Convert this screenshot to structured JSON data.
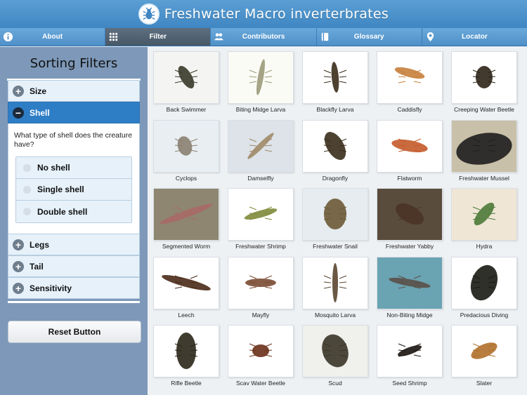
{
  "app": {
    "title": "Freshwater Macro inverterbrates",
    "logo_icon": "bug-icon"
  },
  "tabs": [
    {
      "label": "About",
      "icon": "info-icon",
      "active": false
    },
    {
      "label": "Filter",
      "icon": "grid-icon",
      "active": true
    },
    {
      "label": "Contributors",
      "icon": "people-icon",
      "active": false
    },
    {
      "label": "Glossary",
      "icon": "book-icon",
      "active": false
    },
    {
      "label": "Locator",
      "icon": "pin-icon",
      "active": false
    }
  ],
  "sidebar": {
    "title": "Sorting Filters",
    "filters": {
      "size": "Size",
      "shell": "Shell",
      "legs": "Legs",
      "tail": "Tail",
      "sensitivity": "Sensitivity"
    },
    "shell_question": "What type of shell does the creature have?",
    "shell_options": [
      "No shell",
      "Single shell",
      "Double shell"
    ],
    "reset_label": "Reset Button"
  },
  "creatures": [
    {
      "name": "Back Swimmer",
      "color": "#3a3a2a",
      "bg": "#f4f4f2"
    },
    {
      "name": "Biting Midge Larva",
      "color": "#9b9a7a",
      "bg": "#fbfbf6"
    },
    {
      "name": "Blackfly Larva",
      "color": "#3b2c1a",
      "bg": "#ffffff"
    },
    {
      "name": "Caddisfly",
      "color": "#c7803b",
      "bg": "#ffffff"
    },
    {
      "name": "Creeping Water Beetle",
      "color": "#2d2418",
      "bg": "#ffffff"
    },
    {
      "name": "Cyclops",
      "color": "#8a8070",
      "bg": "#e8eef2"
    },
    {
      "name": "Damselfly",
      "color": "#a08a68",
      "bg": "#dde3e8"
    },
    {
      "name": "Dragonfly",
      "color": "#3a2e1c",
      "bg": "#ffffff"
    },
    {
      "name": "Flatworm",
      "color": "#c45a2a",
      "bg": "#ffffff"
    },
    {
      "name": "Freshwater Mussel",
      "color": "#1e1e1e",
      "bg": "#c8c0a8"
    },
    {
      "name": "Segmented Worm",
      "color": "#a86a66",
      "bg": "#8e8670"
    },
    {
      "name": "Freshwater Shrimp",
      "color": "#7f8a3a",
      "bg": "#ffffff"
    },
    {
      "name": "Freshwater Snail",
      "color": "#6b5a36",
      "bg": "#e6ecef"
    },
    {
      "name": "Freshwater Yabby",
      "color": "#4a3426",
      "bg": "#5a4c3c"
    },
    {
      "name": "Hydra",
      "color": "#4d7a3a",
      "bg": "#efe6d6"
    },
    {
      "name": "Leech",
      "color": "#4a2a18",
      "bg": "#ffffff"
    },
    {
      "name": "Mayfly",
      "color": "#7a4a32",
      "bg": "#ffffff"
    },
    {
      "name": "Mosquito Larva",
      "color": "#5a4630",
      "bg": "#ffffff"
    },
    {
      "name": "Non-Biting Midge",
      "color": "#5a5048",
      "bg": "#6aa3b2"
    },
    {
      "name": "Predacious Diving",
      "color": "#1a1a14",
      "bg": "#ffffff"
    },
    {
      "name": "Rifle Beetle",
      "color": "#2a2618",
      "bg": "#ffffff"
    },
    {
      "name": "Scav Water Beetle",
      "color": "#6a3018",
      "bg": "#ffffff"
    },
    {
      "name": "Scud",
      "color": "#3a3428",
      "bg": "#f0f0ec"
    },
    {
      "name": "Seed Shrimp",
      "color": "#1a1410",
      "bg": "#ffffff"
    },
    {
      "name": "Slater",
      "color": "#b0702a",
      "bg": "#ffffff"
    }
  ]
}
